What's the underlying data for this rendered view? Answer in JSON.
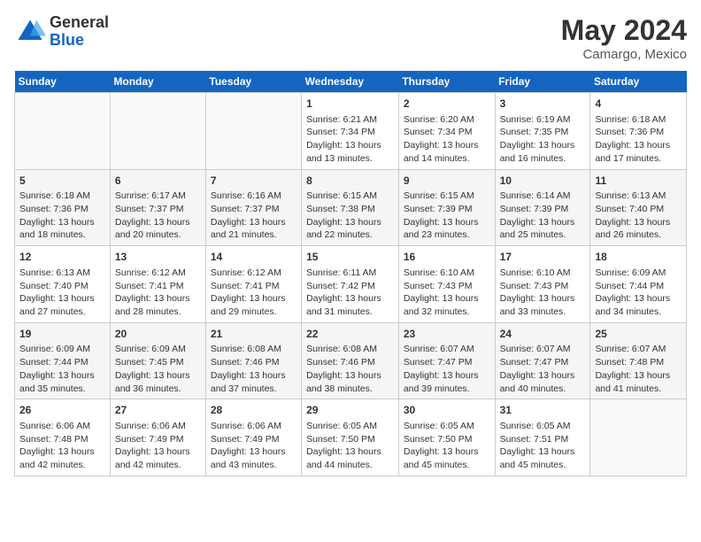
{
  "logo": {
    "general": "General",
    "blue": "Blue"
  },
  "header": {
    "month_year": "May 2024",
    "location": "Camargo, Mexico"
  },
  "days_of_week": [
    "Sunday",
    "Monday",
    "Tuesday",
    "Wednesday",
    "Thursday",
    "Friday",
    "Saturday"
  ],
  "weeks": [
    [
      {
        "day": "",
        "info": ""
      },
      {
        "day": "",
        "info": ""
      },
      {
        "day": "",
        "info": ""
      },
      {
        "day": "1",
        "info": "Sunrise: 6:21 AM\nSunset: 7:34 PM\nDaylight: 13 hours and 13 minutes."
      },
      {
        "day": "2",
        "info": "Sunrise: 6:20 AM\nSunset: 7:34 PM\nDaylight: 13 hours and 14 minutes."
      },
      {
        "day": "3",
        "info": "Sunrise: 6:19 AM\nSunset: 7:35 PM\nDaylight: 13 hours and 16 minutes."
      },
      {
        "day": "4",
        "info": "Sunrise: 6:18 AM\nSunset: 7:36 PM\nDaylight: 13 hours and 17 minutes."
      }
    ],
    [
      {
        "day": "5",
        "info": "Sunrise: 6:18 AM\nSunset: 7:36 PM\nDaylight: 13 hours and 18 minutes."
      },
      {
        "day": "6",
        "info": "Sunrise: 6:17 AM\nSunset: 7:37 PM\nDaylight: 13 hours and 20 minutes."
      },
      {
        "day": "7",
        "info": "Sunrise: 6:16 AM\nSunset: 7:37 PM\nDaylight: 13 hours and 21 minutes."
      },
      {
        "day": "8",
        "info": "Sunrise: 6:15 AM\nSunset: 7:38 PM\nDaylight: 13 hours and 22 minutes."
      },
      {
        "day": "9",
        "info": "Sunrise: 6:15 AM\nSunset: 7:39 PM\nDaylight: 13 hours and 23 minutes."
      },
      {
        "day": "10",
        "info": "Sunrise: 6:14 AM\nSunset: 7:39 PM\nDaylight: 13 hours and 25 minutes."
      },
      {
        "day": "11",
        "info": "Sunrise: 6:13 AM\nSunset: 7:40 PM\nDaylight: 13 hours and 26 minutes."
      }
    ],
    [
      {
        "day": "12",
        "info": "Sunrise: 6:13 AM\nSunset: 7:40 PM\nDaylight: 13 hours and 27 minutes."
      },
      {
        "day": "13",
        "info": "Sunrise: 6:12 AM\nSunset: 7:41 PM\nDaylight: 13 hours and 28 minutes."
      },
      {
        "day": "14",
        "info": "Sunrise: 6:12 AM\nSunset: 7:41 PM\nDaylight: 13 hours and 29 minutes."
      },
      {
        "day": "15",
        "info": "Sunrise: 6:11 AM\nSunset: 7:42 PM\nDaylight: 13 hours and 31 minutes."
      },
      {
        "day": "16",
        "info": "Sunrise: 6:10 AM\nSunset: 7:43 PM\nDaylight: 13 hours and 32 minutes."
      },
      {
        "day": "17",
        "info": "Sunrise: 6:10 AM\nSunset: 7:43 PM\nDaylight: 13 hours and 33 minutes."
      },
      {
        "day": "18",
        "info": "Sunrise: 6:09 AM\nSunset: 7:44 PM\nDaylight: 13 hours and 34 minutes."
      }
    ],
    [
      {
        "day": "19",
        "info": "Sunrise: 6:09 AM\nSunset: 7:44 PM\nDaylight: 13 hours and 35 minutes."
      },
      {
        "day": "20",
        "info": "Sunrise: 6:09 AM\nSunset: 7:45 PM\nDaylight: 13 hours and 36 minutes."
      },
      {
        "day": "21",
        "info": "Sunrise: 6:08 AM\nSunset: 7:46 PM\nDaylight: 13 hours and 37 minutes."
      },
      {
        "day": "22",
        "info": "Sunrise: 6:08 AM\nSunset: 7:46 PM\nDaylight: 13 hours and 38 minutes."
      },
      {
        "day": "23",
        "info": "Sunrise: 6:07 AM\nSunset: 7:47 PM\nDaylight: 13 hours and 39 minutes."
      },
      {
        "day": "24",
        "info": "Sunrise: 6:07 AM\nSunset: 7:47 PM\nDaylight: 13 hours and 40 minutes."
      },
      {
        "day": "25",
        "info": "Sunrise: 6:07 AM\nSunset: 7:48 PM\nDaylight: 13 hours and 41 minutes."
      }
    ],
    [
      {
        "day": "26",
        "info": "Sunrise: 6:06 AM\nSunset: 7:48 PM\nDaylight: 13 hours and 42 minutes."
      },
      {
        "day": "27",
        "info": "Sunrise: 6:06 AM\nSunset: 7:49 PM\nDaylight: 13 hours and 42 minutes."
      },
      {
        "day": "28",
        "info": "Sunrise: 6:06 AM\nSunset: 7:49 PM\nDaylight: 13 hours and 43 minutes."
      },
      {
        "day": "29",
        "info": "Sunrise: 6:05 AM\nSunset: 7:50 PM\nDaylight: 13 hours and 44 minutes."
      },
      {
        "day": "30",
        "info": "Sunrise: 6:05 AM\nSunset: 7:50 PM\nDaylight: 13 hours and 45 minutes."
      },
      {
        "day": "31",
        "info": "Sunrise: 6:05 AM\nSunset: 7:51 PM\nDaylight: 13 hours and 45 minutes."
      },
      {
        "day": "",
        "info": ""
      }
    ]
  ]
}
